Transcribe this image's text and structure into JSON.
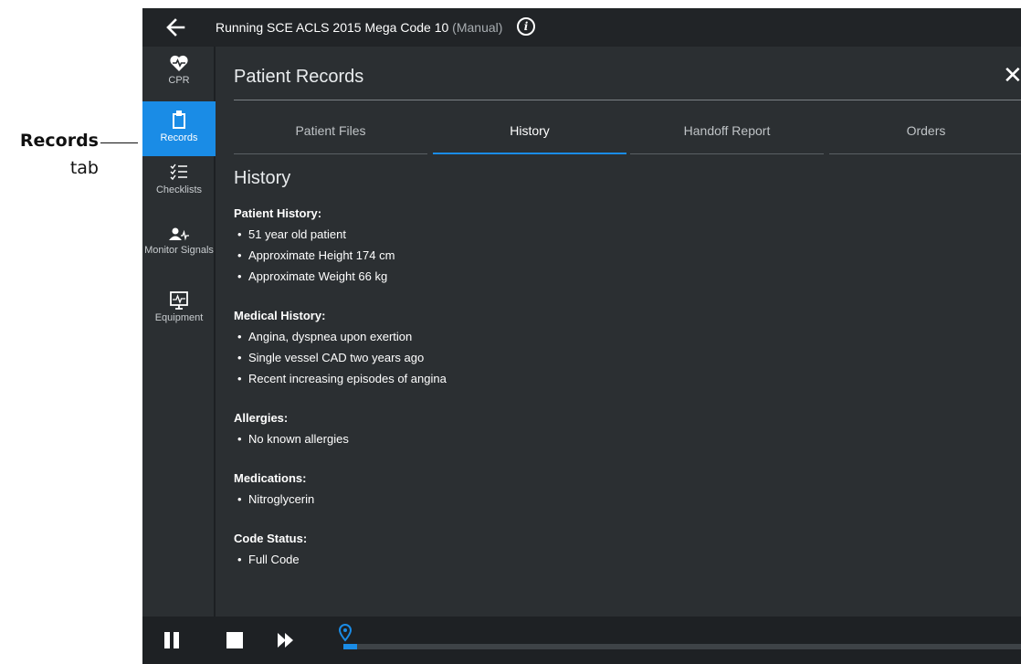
{
  "callout": {
    "title": "Records",
    "subtitle": "tab"
  },
  "topbar": {
    "back_icon": "arrow-left-icon",
    "run_label": "Running SCE  ACLS 2015 Mega Code 10",
    "mode_label": "(Manual)",
    "info_icon_glyph": "i"
  },
  "sidebar": {
    "items": [
      {
        "icon": "heart-pulse-icon",
        "label": "CPR"
      },
      {
        "icon": "clipboard-icon",
        "label": "Records"
      },
      {
        "icon": "checklist-icon",
        "label": "Checklists"
      },
      {
        "icon": "user-signal-icon",
        "label": "Monitor Signals"
      },
      {
        "icon": "monitor-icon",
        "label": "Equipment"
      }
    ],
    "active": "Records"
  },
  "panel": {
    "title": "Patient Records",
    "close_glyph": "✕",
    "tabs": [
      "Patient Files",
      "History",
      "Handoff Report",
      "Orders"
    ],
    "active_tab": "History"
  },
  "history": {
    "title": "History",
    "groups": [
      {
        "heading": "Patient History:",
        "items": [
          "51 year old patient",
          "Approximate Height 174 cm",
          "Approximate Weight 66 kg"
        ]
      },
      {
        "heading": "Medical History:",
        "items": [
          "Angina, dyspnea upon exertion",
          "Single vessel CAD two years ago",
          "Recent increasing episodes of angina"
        ]
      },
      {
        "heading": "Allergies:",
        "items": [
          "No known allergies"
        ]
      },
      {
        "heading": "Medications:",
        "items": [
          "Nitroglycerin"
        ]
      },
      {
        "heading": "Code Status:",
        "items": [
          "Full Code"
        ]
      }
    ]
  },
  "playback": {
    "controls": [
      "pause-icon",
      "stop-icon",
      "fast-forward-icon"
    ],
    "progress": 0.02
  },
  "colors": {
    "accent": "#1a8ce6",
    "background": "#2b2f32",
    "topbar": "#212427"
  }
}
